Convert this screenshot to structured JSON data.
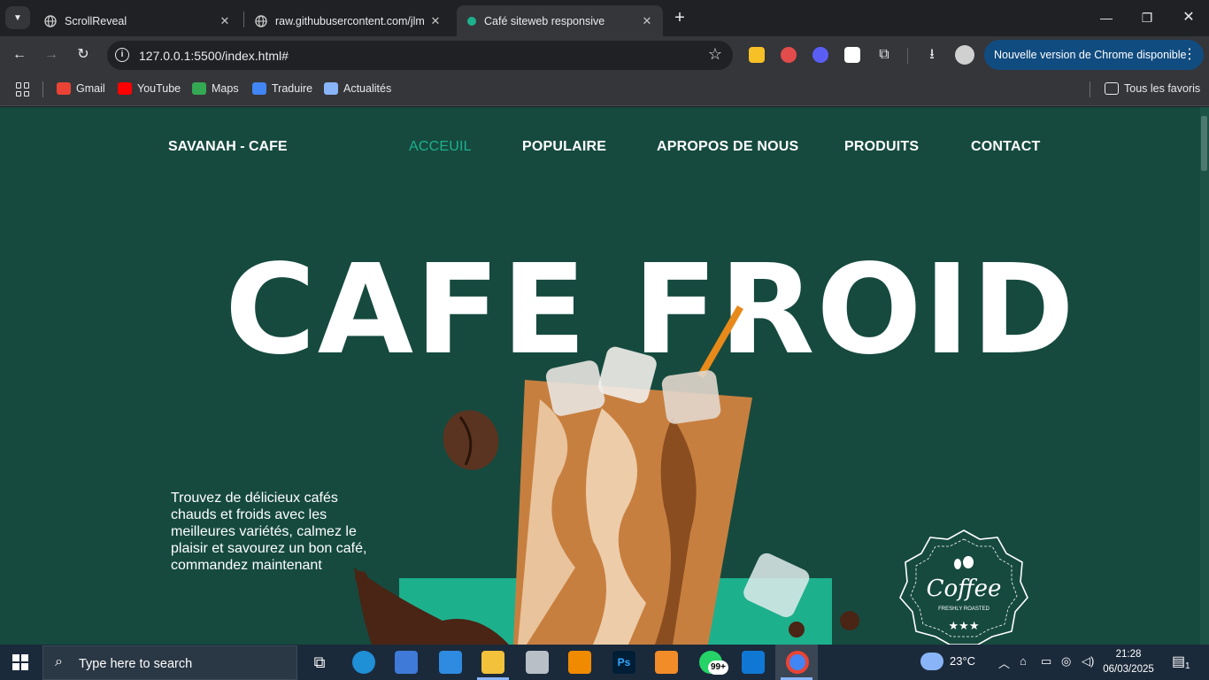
{
  "browser": {
    "tabs": [
      {
        "title": "ScrollReveal",
        "active": false
      },
      {
        "title": "raw.githubusercontent.com/jlm",
        "active": false
      },
      {
        "title": "Café siteweb responsive",
        "active": true
      }
    ],
    "url": "127.0.0.1:5500/index.html#",
    "update_button": "Nouvelle version de Chrome disponible",
    "bookmarks": [
      {
        "label": "Gmail",
        "icon": "gmail-icon",
        "color": "#ea4335"
      },
      {
        "label": "YouTube",
        "icon": "youtube-icon",
        "color": "#ff0000"
      },
      {
        "label": "Maps",
        "icon": "maps-icon",
        "color": "#34a853"
      },
      {
        "label": "Traduire",
        "icon": "translate-icon",
        "color": "#4285f4"
      },
      {
        "label": "Actualités",
        "icon": "news-icon",
        "color": "#8ab4f8"
      }
    ],
    "all_bookmarks": "Tous les favoris"
  },
  "site": {
    "logo": "SAVANAH - CAFE",
    "nav": [
      "ACCEUIL",
      "POPULAIRE",
      "APROPOS DE NOUS",
      "PRODUITS",
      "CONTACT"
    ],
    "active_nav": "ACCEUIL",
    "hero_title": "CAFE FROID",
    "hero_text": "Trouvez de délicieux cafés chauds et froids avec les meilleures variétés, calmez le plaisir et savourez un bon café, commandez maintenant",
    "badge_title": "Coffee",
    "badge_sub": "FRESHLY ROASTED",
    "colors": {
      "background": "#164a3f",
      "accent": "#1db08d",
      "text": "#ffffff"
    }
  },
  "taskbar": {
    "search_placeholder": "Type here to search",
    "notification_badge": "99+",
    "weather": "23°C",
    "time": "21:28",
    "date": "06/03/2025",
    "notification_count": "1"
  }
}
